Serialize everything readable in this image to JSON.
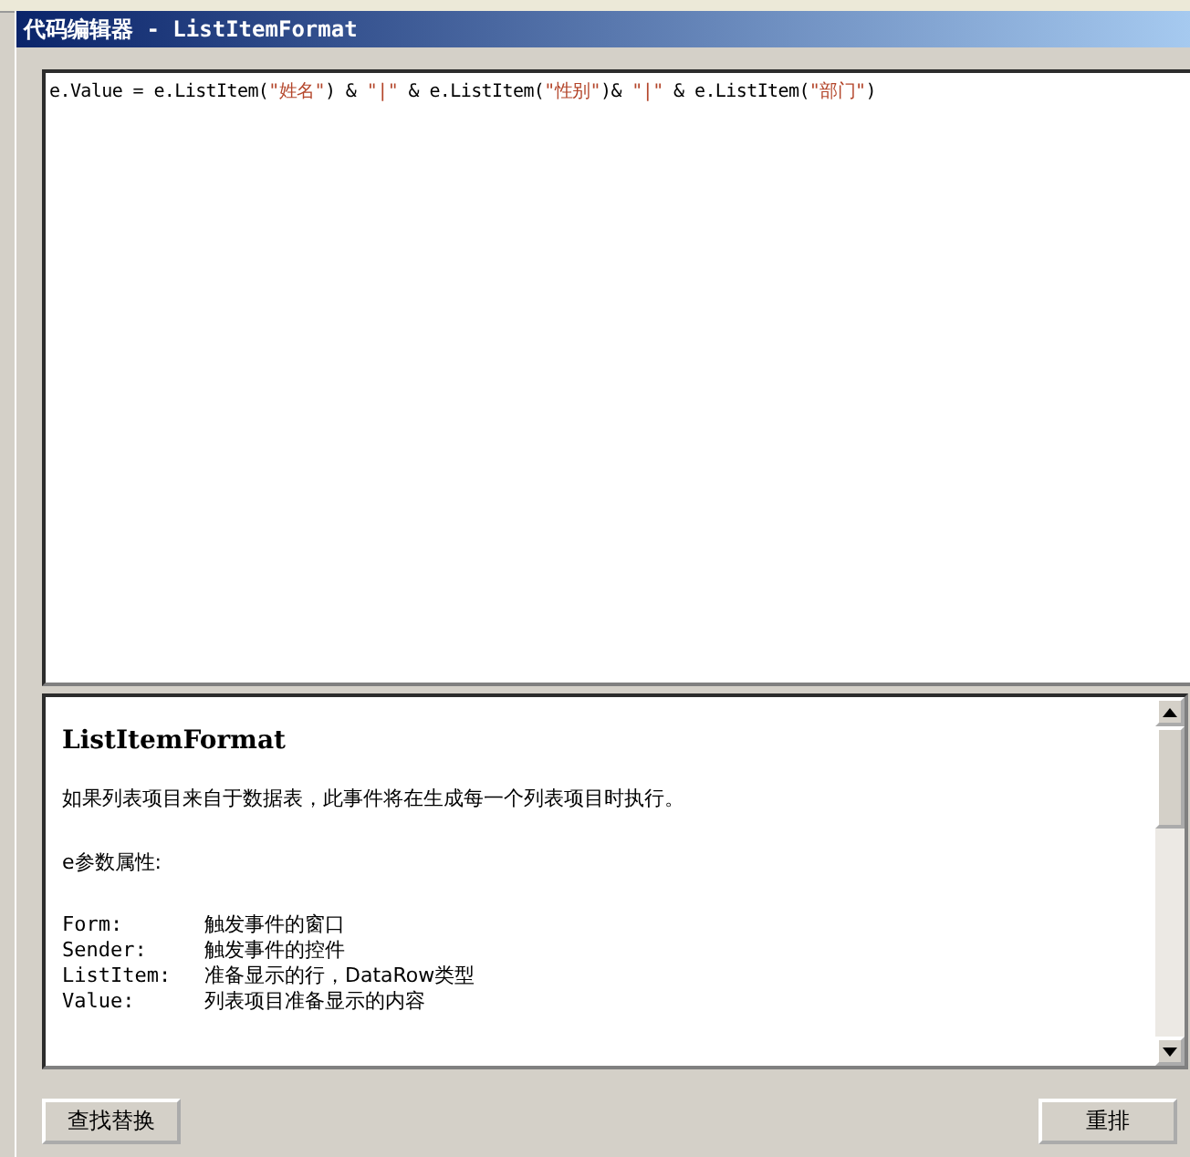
{
  "window": {
    "title": "代码编辑器 - ListItemFormat"
  },
  "code": {
    "tokens": [
      {
        "kind": "plain",
        "text": "e.Value = e.ListItem("
      },
      {
        "kind": "string",
        "text": "\"姓名\""
      },
      {
        "kind": "plain",
        "text": ") & "
      },
      {
        "kind": "string",
        "text": "\"|\""
      },
      {
        "kind": "plain",
        "text": " & e.ListItem("
      },
      {
        "kind": "string",
        "text": "\"性别\""
      },
      {
        "kind": "plain",
        "text": ")& "
      },
      {
        "kind": "string",
        "text": "\"|\""
      },
      {
        "kind": "plain",
        "text": " & e.ListItem("
      },
      {
        "kind": "string",
        "text": "\"部门\""
      },
      {
        "kind": "plain",
        "text": ")"
      }
    ]
  },
  "help": {
    "title": "ListItemFormat",
    "description": "如果列表项目来自于数据表，此事件将在生成每一个列表项目时执行。",
    "params_heading": "e参数属性:",
    "params": [
      {
        "name": "Form:",
        "text": "触发事件的窗口"
      },
      {
        "name": "Sender:",
        "text": "触发事件的控件"
      },
      {
        "name": "ListItem:",
        "text": "准备显示的行，DataRow类型"
      },
      {
        "name": "Value:",
        "text": "列表项目准备显示的内容"
      }
    ]
  },
  "buttons": [
    {
      "label": "查找替换"
    },
    {
      "label": "重排"
    }
  ]
}
